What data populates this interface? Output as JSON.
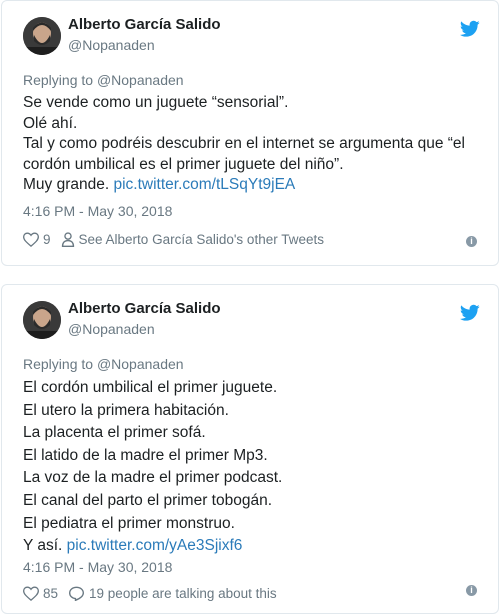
{
  "tweets": [
    {
      "author": {
        "name": "Alberto García Salido",
        "handle": "@Nopanaden"
      },
      "replying_prefix": "Replying to",
      "replying_handle": "@Nopanaden",
      "lines": [
        "Se vende como un juguete “sensorial”.",
        "Olé ahí.",
        "Tal y como podréis descubrir en el internet se argumenta que “el",
        "cordón umbilical es el primer juguete del niño”."
      ],
      "last_line_text": "Muy grande.",
      "link": "pic.twitter.com/tLSqYt9jEA",
      "timestamp": "4:16 PM - May 30, 2018",
      "likes": "9",
      "other_link": "See Alberto García Salido's other Tweets",
      "info_icon": "info-icon",
      "brand_color": "#1da1f2",
      "link_color": "#2b7bb9"
    },
    {
      "author": {
        "name": "Alberto García Salido",
        "handle": "@Nopanaden"
      },
      "replying_prefix": "Replying to",
      "replying_handle": "@Nopanaden",
      "lines": [
        "El cordón umbilical el primer juguete.",
        "El utero la primera habitación.",
        "La placenta el primer sofá.",
        "El latido de la madre el primer Mp3.",
        "La voz de la madre el primer podcast.",
        "El canal del parto el primer tobogán.",
        "El pediatra el primer monstruo."
      ],
      "last_line_text": "Y así.",
      "link": "pic.twitter.com/yAe3Sjixf6",
      "timestamp": "4:16 PM - May 30, 2018",
      "likes": "85",
      "talking": "19 people are talking about this",
      "info_icon": "info-icon"
    }
  ]
}
